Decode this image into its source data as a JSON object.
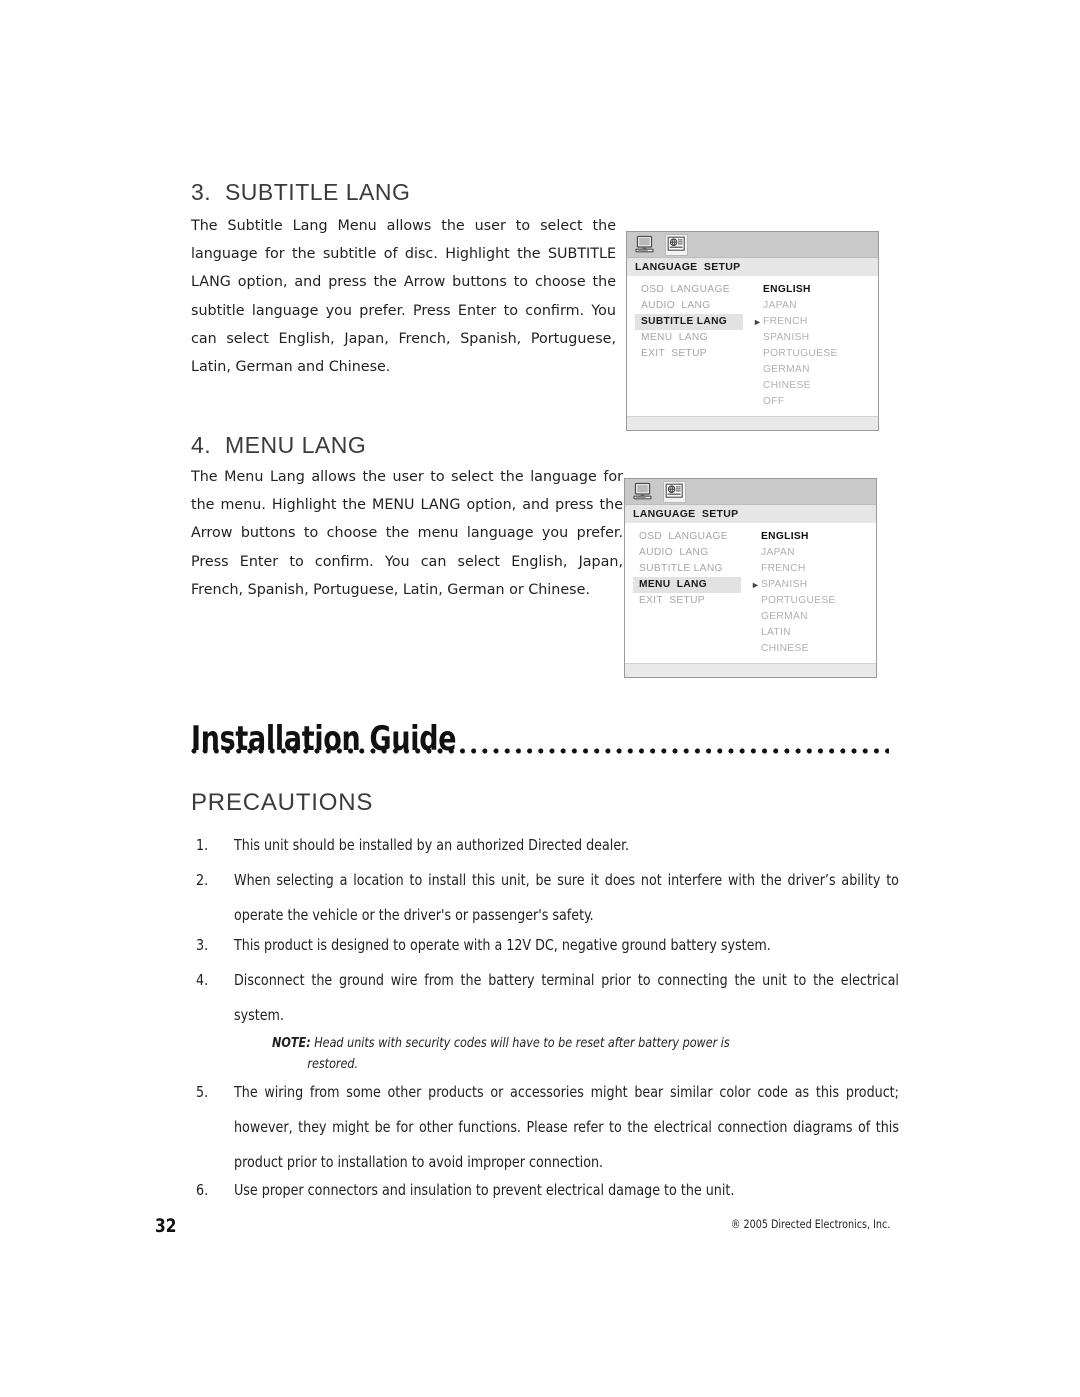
{
  "sections": [
    {
      "heading": "3.  SUBTITLE LANG",
      "body": "The Subtitle Lang Menu allows the user to select the language for the subtitle of disc. Highlight the SUBTITLE LANG option, and press the Arrow buttons to choose the subtitle language you prefer. Press Enter to confirm. You can select English, Japan, French, Spanish, Portuguese, Latin, German and Chinese."
    },
    {
      "heading": "4.  MENU LANG",
      "body": "The Menu Lang allows the user to select the language for the menu. Highlight the MENU LANG option, and press the Arrow buttons to choose the menu language you prefer. Press Enter to confirm. You can select English, Japan, French, Spanish, Portuguese, Latin, German or Chinese."
    }
  ],
  "osd_menus": [
    {
      "icons": [
        "monitor-icon",
        "language-globe-icon"
      ],
      "selected_icon_index": 1,
      "title": "LANGUAGE  SETUP",
      "left_items": [
        {
          "label": "OSD  LANGUAGE",
          "active": false
        },
        {
          "label": "AUDIO  LANG",
          "active": false
        },
        {
          "label": "SUBTITLE LANG",
          "active": true
        },
        {
          "label": "MENU  LANG",
          "active": false
        },
        {
          "label": "EXIT  SETUP",
          "active": false
        }
      ],
      "options": [
        {
          "label": "ENGLISH",
          "current": true,
          "marked": false
        },
        {
          "label": "JAPAN",
          "current": false,
          "marked": false
        },
        {
          "label": "FRENCH",
          "current": false,
          "marked": true
        },
        {
          "label": "SPANISH",
          "current": false,
          "marked": false
        },
        {
          "label": "PORTUGUESE",
          "current": false,
          "marked": false
        },
        {
          "label": "GERMAN",
          "current": false,
          "marked": false
        },
        {
          "label": "CHINESE",
          "current": false,
          "marked": false
        },
        {
          "label": "OFF",
          "current": false,
          "marked": false
        }
      ]
    },
    {
      "icons": [
        "monitor-icon",
        "language-globe-icon"
      ],
      "selected_icon_index": 1,
      "title": "LANGUAGE  SETUP",
      "left_items": [
        {
          "label": "OSD  LANGUAGE",
          "active": false
        },
        {
          "label": "AUDIO  LANG",
          "active": false
        },
        {
          "label": "SUBTITLE LANG",
          "active": false
        },
        {
          "label": "MENU  LANG",
          "active": true
        },
        {
          "label": "EXIT  SETUP",
          "active": false
        }
      ],
      "options": [
        {
          "label": "ENGLISH",
          "current": true,
          "marked": false
        },
        {
          "label": "JAPAN",
          "current": false,
          "marked": false
        },
        {
          "label": "FRENCH",
          "current": false,
          "marked": false
        },
        {
          "label": "SPANISH",
          "current": false,
          "marked": true
        },
        {
          "label": "PORTUGUESE",
          "current": false,
          "marked": false
        },
        {
          "label": "GERMAN",
          "current": false,
          "marked": false
        },
        {
          "label": "LATIN",
          "current": false,
          "marked": false
        },
        {
          "label": "CHINESE",
          "current": false,
          "marked": false
        }
      ]
    }
  ],
  "guide": {
    "title": "Installation Guide",
    "precautions_heading": "PRECAUTIONS",
    "items": [
      {
        "num": "1.",
        "text": "This unit should be installed by an authorized Directed dealer."
      },
      {
        "num": "2.",
        "text": "When selecting a location to install this unit, be sure it does not interfere with the driver’s ability to operate the vehicle or the driver's or passenger's safety."
      },
      {
        "num": "3.",
        "text": "This product is designed to operate with a 12V DC, negative ground battery system."
      },
      {
        "num": "4.",
        "text": "Disconnect the ground wire from the battery terminal prior to connecting the unit to the electrical system."
      },
      {
        "num": "5.",
        "text": "The wiring from some other products or accessories might bear similar color code as this product; however, they might be for other functions. Please refer to the electrical connection diagrams of this product prior to installation to avoid improper connection."
      },
      {
        "num": "6.",
        "text": "Use proper connectors and insulation to prevent electrical damage to the unit."
      }
    ],
    "note_label": "NOTE:",
    "note_text_line1": "Head units with security codes will have to be reset after battery power is",
    "note_text_line2": "restored."
  },
  "footer": {
    "page_number": "32",
    "copyright": "® 2005 Directed Electronics, Inc."
  },
  "colors": {
    "text": "#231f20",
    "heading": "#3b3b3b",
    "osd_header": "#c9c9c9",
    "osd_titlebar": "#e6e6e6",
    "osd_dim": "#b0b0b0",
    "osd_active_bg": "#e2e2e2"
  }
}
